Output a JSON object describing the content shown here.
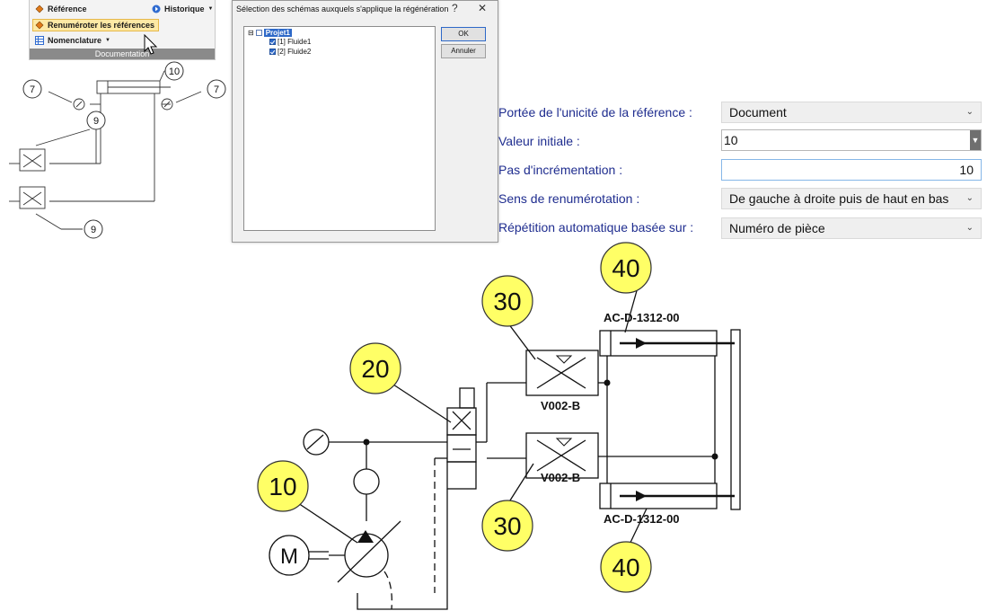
{
  "ribbon": {
    "reference_label": "Référence",
    "history_label": "Historique",
    "renumber_label": "Renuméroter les références",
    "bom_label": "Nomenclature",
    "group_label": "Documentation"
  },
  "dialog": {
    "title": "Sélection des schémas auxquels s'applique la régénération",
    "help_glyph": "?",
    "close_glyph": "✕",
    "tree": {
      "root": "Projet1",
      "children": [
        "[1] Fluide1",
        "[2] Fluide2"
      ]
    },
    "ok_label": "OK",
    "cancel_label": "Annuler"
  },
  "properties": [
    {
      "label": "Portée de l'unicité de la référence :",
      "value": "Document"
    },
    {
      "label": "Valeur initiale :",
      "value": "10"
    },
    {
      "label": "Pas d'incrémentation :",
      "value": "10"
    },
    {
      "label": "Sens de renumérotation :",
      "value": "De gauche à droite puis de haut en bas"
    },
    {
      "label": "Répétition automatique basée sur :",
      "value": "Numéro de pièce"
    }
  ],
  "small_schematic": {
    "balloons": [
      "10",
      "7",
      "7",
      "9",
      "9"
    ]
  },
  "schematic": {
    "balloons": [
      "40",
      "30",
      "20",
      "10",
      "30",
      "40"
    ],
    "part_labels": [
      "AC-D-1312-00",
      "V002-B",
      "V002-B",
      "AC-D-1312-00"
    ],
    "motor_letter": "M"
  },
  "colors": {
    "balloon_fill": "#ffff66",
    "label_blue": "#1f2d8f",
    "ribbon_highlight": "#fde9a5"
  }
}
